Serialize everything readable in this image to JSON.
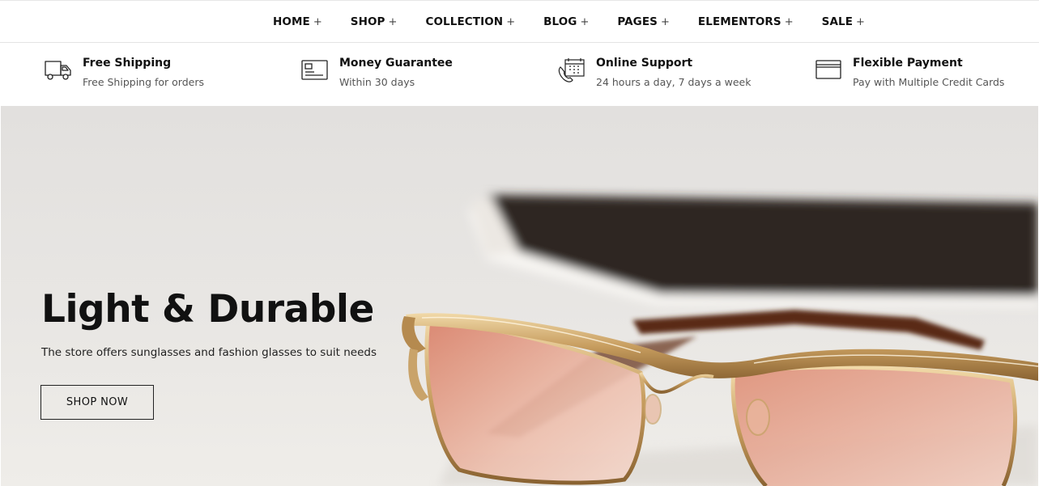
{
  "nav": {
    "items": [
      {
        "label": "HOME",
        "suffix": "+"
      },
      {
        "label": "SHOP",
        "suffix": "+"
      },
      {
        "label": "COLLECTION",
        "suffix": "+"
      },
      {
        "label": "BLOG",
        "suffix": "+"
      },
      {
        "label": "PAGES",
        "suffix": "+"
      },
      {
        "label": "ELEMENTORS",
        "suffix": "+"
      },
      {
        "label": "SALE",
        "suffix": "+"
      }
    ]
  },
  "features": [
    {
      "icon": "truck-icon",
      "title": "Free Shipping",
      "subtitle": "Free Shipping for orders"
    },
    {
      "icon": "id-card-icon",
      "title": "Money Guarantee",
      "subtitle": "Within 30 days"
    },
    {
      "icon": "phone-calendar-icon",
      "title": "Online Support",
      "subtitle": "24 hours a day, 7 days a week"
    },
    {
      "icon": "credit-card-icon",
      "title": "Flexible Payment",
      "subtitle": "Pay with Multiple Credit Cards"
    }
  ],
  "hero": {
    "heading": "Light & Durable",
    "text": "The store offers sunglasses and fashion glasses to suit needs",
    "button": "SHOP NOW",
    "image": "eyeglasses-photo"
  },
  "colors": {
    "text": "#111111",
    "muted": "#555555",
    "hero_bg": "#e8e6e4",
    "book": "#2e2620",
    "frame_gold": "#c9a36a",
    "lens": "#e8b4a0"
  }
}
